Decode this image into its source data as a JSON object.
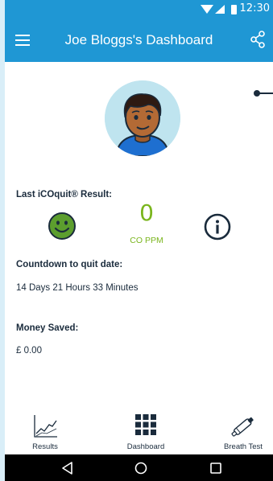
{
  "status_bar": {
    "time": "12:30"
  },
  "app_bar": {
    "title": "Joe Bloggs's Dashboard"
  },
  "result": {
    "label": "Last iCOquit® Result:",
    "co_value": "0",
    "co_unit": "CO PPM"
  },
  "countdown": {
    "label": "Countdown to quit date:",
    "value": "14 Days 21 Hours 33 Minutes"
  },
  "money": {
    "label": "Money Saved:",
    "value": "£ 0.00"
  },
  "bottom_nav": {
    "items": [
      {
        "label": "Results",
        "icon": "line-chart-icon"
      },
      {
        "label": "Dashboard",
        "icon": "grid-icon"
      },
      {
        "label": "Breath Test",
        "icon": "breath-device-icon"
      }
    ]
  },
  "colors": {
    "primary": "#1f97d4",
    "accent_green": "#7ab51d",
    "text": "#1a2b3c"
  }
}
